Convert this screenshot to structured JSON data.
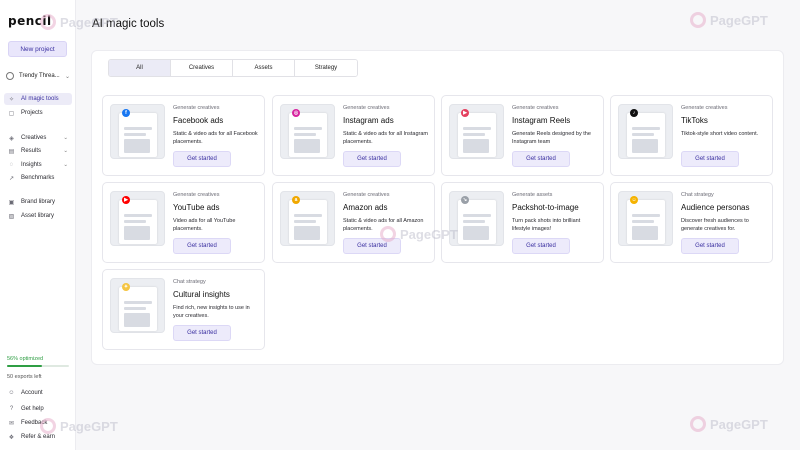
{
  "app": {
    "logo": "pencil",
    "page_title": "AI magic tools"
  },
  "sidebar": {
    "new_project": "New project",
    "workspace": "Trendy Threa...",
    "top_items": [
      {
        "label": "Projects",
        "icon": "file-icon"
      },
      {
        "label": "AI magic tools",
        "icon": "wand-icon",
        "active": true
      }
    ],
    "mid_items": [
      {
        "label": "Creatives",
        "icon": "layers-icon"
      },
      {
        "label": "Results",
        "icon": "chart-icon"
      },
      {
        "label": "Insights",
        "icon": "bulb-icon"
      },
      {
        "label": "Benchmarks",
        "icon": "trend-icon"
      }
    ],
    "lib_items": [
      {
        "label": "Brand library",
        "icon": "brand-icon"
      },
      {
        "label": "Asset library",
        "icon": "image-icon"
      }
    ],
    "optimized": "56% optimized",
    "optimized_progress": 0.56,
    "exports": "50 exports left",
    "bottom_items": [
      {
        "label": "Account",
        "icon": "user-icon"
      },
      {
        "label": "Get help",
        "icon": "help-icon"
      },
      {
        "label": "Feedback",
        "icon": "chat-icon"
      },
      {
        "label": "Refer & earn",
        "icon": "gift-icon"
      }
    ]
  },
  "tabs": [
    "All",
    "Creatives",
    "Assets",
    "Strategy"
  ],
  "cards": [
    {
      "kicker": "Generate creatives",
      "title": "Facebook ads",
      "desc": "Static & video ads for all Facebook placements.",
      "button": "Get started",
      "badge_color": "#1877f2",
      "badge_icon": "f"
    },
    {
      "kicker": "Generate creatives",
      "title": "Instagram ads",
      "desc": "Static & video ads for all Instagram placements.",
      "button": "Get started",
      "badge_color": "#d6249f",
      "badge_icon": "◎"
    },
    {
      "kicker": "Generate creatives",
      "title": "Instagram Reels",
      "desc": "Generate Reels designed by the Instagram team",
      "button": "Get started",
      "badge_color": "#e4405f",
      "badge_icon": "▶"
    },
    {
      "kicker": "Generate creatives",
      "title": "TikToks",
      "desc": "Tiktok-style short video content.",
      "button": "Get started",
      "badge_color": "#111111",
      "badge_icon": "♪"
    },
    {
      "kicker": "Generate creatives",
      "title": "YouTube ads",
      "desc": "Video ads for all YouTube placements.",
      "button": "Get started",
      "badge_color": "#ff0000",
      "badge_icon": "▶"
    },
    {
      "kicker": "Generate creatives",
      "title": "Amazon ads",
      "desc": "Static & video ads for all Amazon placements.",
      "button": "Get started",
      "badge_color": "#f0a800",
      "badge_icon": "a"
    },
    {
      "kicker": "Generate assets",
      "title": "Packshot-to-image",
      "desc": "Turn pack shots into brilliant lifestyle images!",
      "button": "Get started",
      "badge_color": "#9aa0a8",
      "badge_icon": "↘"
    },
    {
      "kicker": "Chat strategy",
      "title": "Audience personas",
      "desc": "Discover fresh audiences to generate creatives for.",
      "button": "Get started",
      "badge_color": "#f5b301",
      "badge_icon": "☺"
    },
    {
      "kicker": "Chat strategy",
      "title": "Cultural insights",
      "desc": "Find rich, new insights to use in your creatives.",
      "button": "Get started",
      "badge_color": "#f5c542",
      "badge_icon": "✦"
    }
  ],
  "watermark": "PageGPT"
}
